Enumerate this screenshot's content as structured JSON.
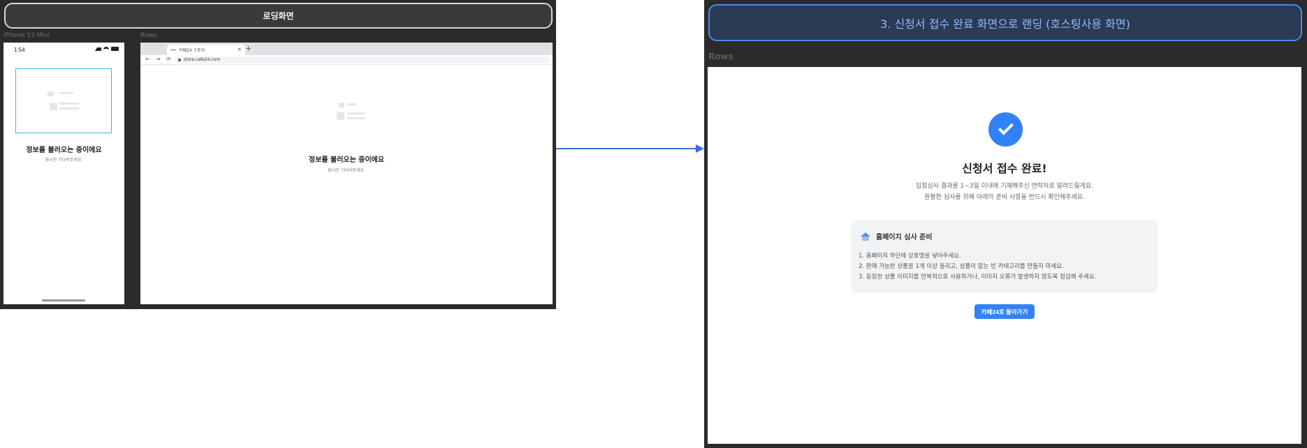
{
  "left_board": {
    "title": "로딩화면",
    "phone_label": "iPhone 13 Mini",
    "browser_label": "Rows"
  },
  "phone": {
    "time": "1:54",
    "loading_title": "정보를 불러오는 중이에요",
    "loading_sub": "잠시만 기다려주세요."
  },
  "browser": {
    "tab_title": "카페24 스토어",
    "close_glyph": "×",
    "new_tab_glyph": "+",
    "back_glyph": "←",
    "forward_glyph": "→",
    "reload_glyph": "⟳",
    "url": "store.cafe24.com",
    "loading_title": "정보를 불러오는 중이에요",
    "loading_sub": "잠시만 기다려주세요."
  },
  "right_board": {
    "title": "3. 신청서 접수 완료 화면으로 랜딩 (호스팅사용 화면)",
    "rows_label": "Rows"
  },
  "completion": {
    "title": "신청서 접수 완료!",
    "line1": "입점심사 결과를 1~3일 이내에 기재해주신 연락처로 알려드릴게요.",
    "line2": "원활한 심사를 위해 아래의 준비 사항을 반드시 확인해주세요.",
    "guide_title": "홈페이지 심사 준비",
    "guide_items": [
      "1. 홈페이지 하단에 상호명을 넣어주세요.",
      "2. 판매 가능한 상품을 1개 이상 올리고, 상품이 없는 빈 카테고리를 만들지 마세요.",
      "3. 동일한 상품 이미지를 반복적으로 사용하거나, 이미지 오류가 발생하지 않도록 점검해 주세요."
    ],
    "back_button": "카페24로 돌아가기"
  },
  "colors": {
    "accent": "#3182f6",
    "pill_border": "#4a8bf0",
    "board_bg": "#2b2b2b"
  }
}
